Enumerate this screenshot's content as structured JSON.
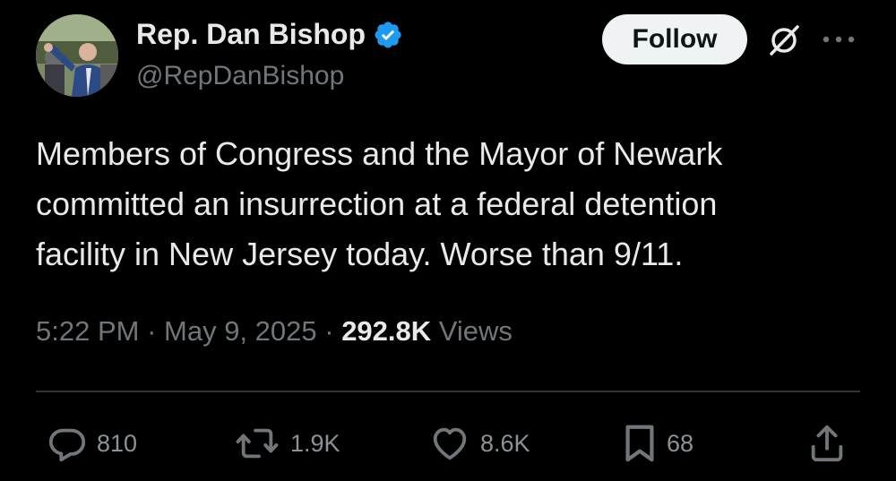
{
  "author": {
    "display_name": "Rep. Dan Bishop",
    "handle": "@RepDanBishop",
    "verified_icon": "verified-badge-icon"
  },
  "header": {
    "follow_label": "Follow",
    "grok_icon": "grok-icon",
    "more_icon": "more-options-icon"
  },
  "tweet": {
    "text": "Members of Congress and the Mayor of Newark\ncommitted an insurrection at a federal detention\nfacility in New Jersey today. Worse than 9/11.",
    "time": "5:22 PM",
    "separator": " · ",
    "date": "May 9, 2025",
    "views_count": "292.8K",
    "views_label": " Views"
  },
  "actions": {
    "replies": "810",
    "reposts": "1.9K",
    "likes": "8.6K",
    "bookmarks": "68"
  },
  "colors": {
    "background": "#000000",
    "text_primary": "#e7e9ea",
    "text_secondary": "#71767b",
    "verified_blue": "#1d9bf0",
    "follow_bg": "#eff3f4",
    "divider": "#2f3336"
  }
}
